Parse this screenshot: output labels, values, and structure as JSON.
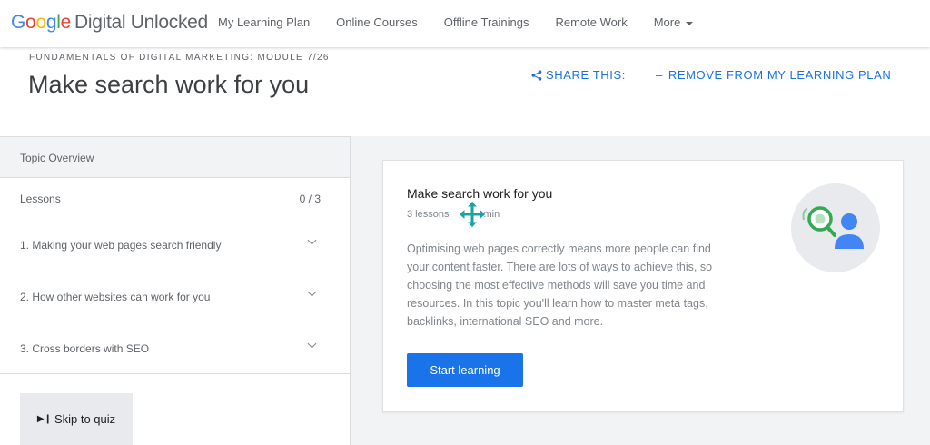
{
  "brand": {
    "google": [
      "G",
      "o",
      "o",
      "g",
      "l",
      "e"
    ],
    "product": "Digital Unlocked"
  },
  "nav": {
    "items": [
      "My Learning Plan",
      "Online Courses",
      "Offline Trainings",
      "Remote Work",
      "More"
    ]
  },
  "header": {
    "module_label": "FUNDAMENTALS OF DIGITAL MARKETING: MODULE 7/26",
    "title": "Make search work for you",
    "share_label": "SHARE THIS:",
    "remove_label": "REMOVE FROM MY LEARNING PLAN"
  },
  "sidebar": {
    "topic_overview": "Topic Overview",
    "lessons_label": "Lessons",
    "lessons_count": "0 / 3",
    "lessons": [
      "1. Making your web pages search friendly",
      "2. How other websites can work for you",
      "3. Cross borders with SEO"
    ],
    "skip_label": "Skip to quiz"
  },
  "card": {
    "title": "Make search work for you",
    "lessons_count": "3 lessons",
    "duration_suffix": "min",
    "description": "Optimising web pages correctly means more people can find your content faster. There are lots of ways to achieve this, so choosing the most effective methods will save you time and resources. In this topic you'll learn how to master meta tags, backlinks, international SEO and more.",
    "start_label": "Start learning",
    "illustration_icon": "search-person-icon"
  },
  "colors": {
    "accent": "#1a73e8",
    "google_blue": "#4285F4",
    "google_red": "#EA4335",
    "google_yellow": "#FBBC05",
    "google_green": "#34A853",
    "panel_bg": "#f1f3f4",
    "cursor_teal": "#1aa3a3"
  }
}
